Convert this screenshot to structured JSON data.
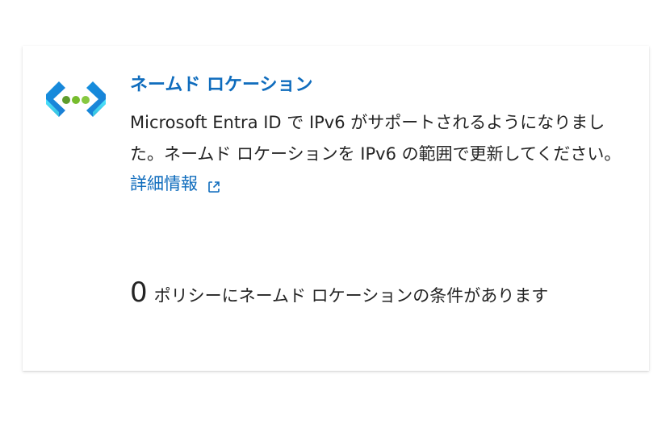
{
  "card": {
    "title": "ネームド ロケーション",
    "description": "Microsoft Entra ID で IPv6 がサポートされるようになりました。ネームド ロケーションを IPv6 の範囲で更新してください。",
    "link_label": "詳細情報",
    "policy_count": "0",
    "policy_text": "ポリシーにネームド ロケーションの条件があります"
  },
  "colors": {
    "title": "#0f6cbd",
    "link": "#0f6cbd",
    "text": "#242424",
    "icon_blue": "#1490df",
    "icon_cyan": "#50e6ff",
    "icon_green": "#5ea0ef"
  },
  "icons": {
    "card_icon": "named-location-icon",
    "link_icon": "external-link-icon"
  }
}
